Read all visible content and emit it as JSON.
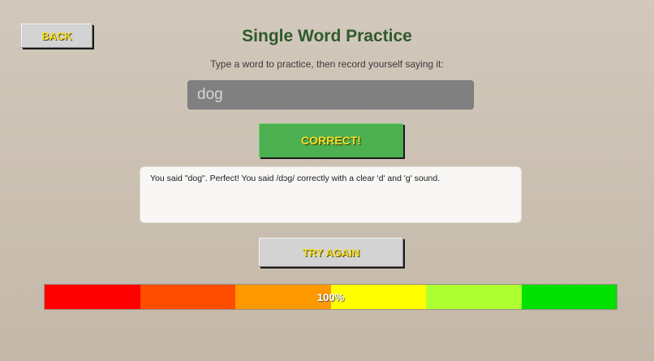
{
  "header": {
    "back_label": "BACK",
    "title": "Single Word Practice",
    "instructions": "Type a word to practice, then record yourself saying it:"
  },
  "word_input": {
    "value": "dog"
  },
  "status": {
    "label": "CORRECT!",
    "color": "#4caf50"
  },
  "feedback": {
    "text": "You said \"dog\". Perfect! You said /dɔg/ correctly with a clear 'd' and 'g' sound."
  },
  "actions": {
    "try_again_label": "TRY AGAIN"
  },
  "score": {
    "label": "100%",
    "value": 100,
    "segments": [
      {
        "color": "#ff0000"
      },
      {
        "color": "#ff4d00"
      },
      {
        "color": "#ff9900"
      },
      {
        "color": "#ffff00"
      },
      {
        "color": "#adff2f"
      },
      {
        "color": "#00e000"
      }
    ]
  },
  "colors": {
    "title": "#2e5a2c",
    "button_text": "#f2df2e",
    "button_bg": "#d3d3d3",
    "input_bg": "#808080"
  }
}
